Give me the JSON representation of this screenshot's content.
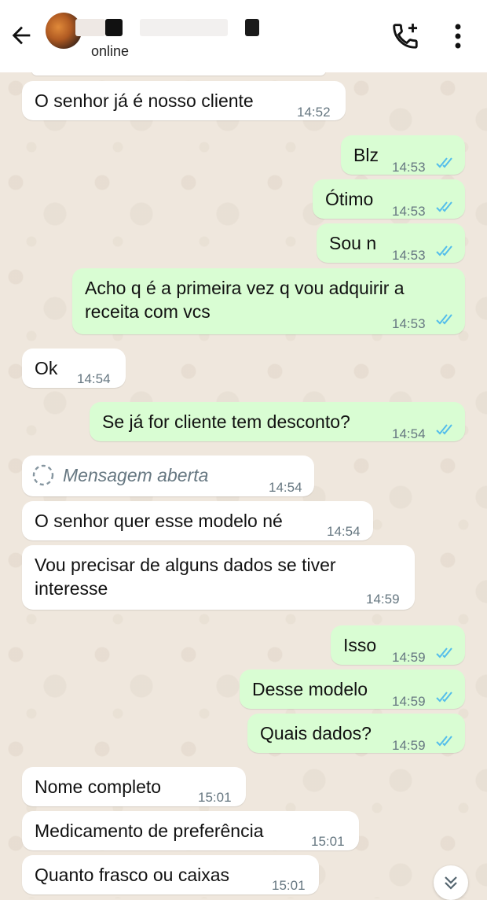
{
  "header": {
    "status": "online",
    "icons": {
      "back": "arrow-left-icon",
      "call": "add-call-icon",
      "menu": "more-vert-icon"
    }
  },
  "messages": [
    {
      "dir": "in",
      "text": "O senhor já é nosso cliente",
      "time": "14:52"
    },
    {
      "dir": "out",
      "text": "Blz",
      "time": "14:53",
      "read": true
    },
    {
      "dir": "out",
      "text": "Ótimo",
      "time": "14:53",
      "read": true
    },
    {
      "dir": "out",
      "text": "Sou n",
      "time": "14:53",
      "read": true
    },
    {
      "dir": "out",
      "text": "Acho q é a primeira vez q vou adquirir a receita com vcs",
      "time": "14:53",
      "read": true
    },
    {
      "dir": "in",
      "text": "Ok",
      "time": "14:54"
    },
    {
      "dir": "out",
      "text": "Se já for cliente tem desconto?",
      "time": "14:54",
      "read": true
    },
    {
      "dir": "in",
      "text": "Mensagem aberta",
      "time": "14:54",
      "view_once": true
    },
    {
      "dir": "in",
      "text": "O senhor quer esse modelo né",
      "time": "14:54"
    },
    {
      "dir": "in",
      "text": "Vou precisar de alguns dados se tiver interesse",
      "time": "14:59"
    },
    {
      "dir": "out",
      "text": "Isso",
      "time": "14:59",
      "read": true
    },
    {
      "dir": "out",
      "text": "Desse modelo",
      "time": "14:59",
      "read": true
    },
    {
      "dir": "out",
      "text": "Quais dados?",
      "time": "14:59",
      "read": true
    },
    {
      "dir": "in",
      "text": "Nome completo",
      "time": "15:01"
    },
    {
      "dir": "in",
      "text": "Medicamento de preferência",
      "time": "15:01"
    },
    {
      "dir": "in",
      "text": "Quanto frasco ou caixas",
      "time": "15:01"
    }
  ],
  "colors": {
    "incoming": "#ffffff",
    "outgoing": "#d9fdd3",
    "read_tick": "#53bdeb",
    "wallpaper": "#efe7dd"
  }
}
